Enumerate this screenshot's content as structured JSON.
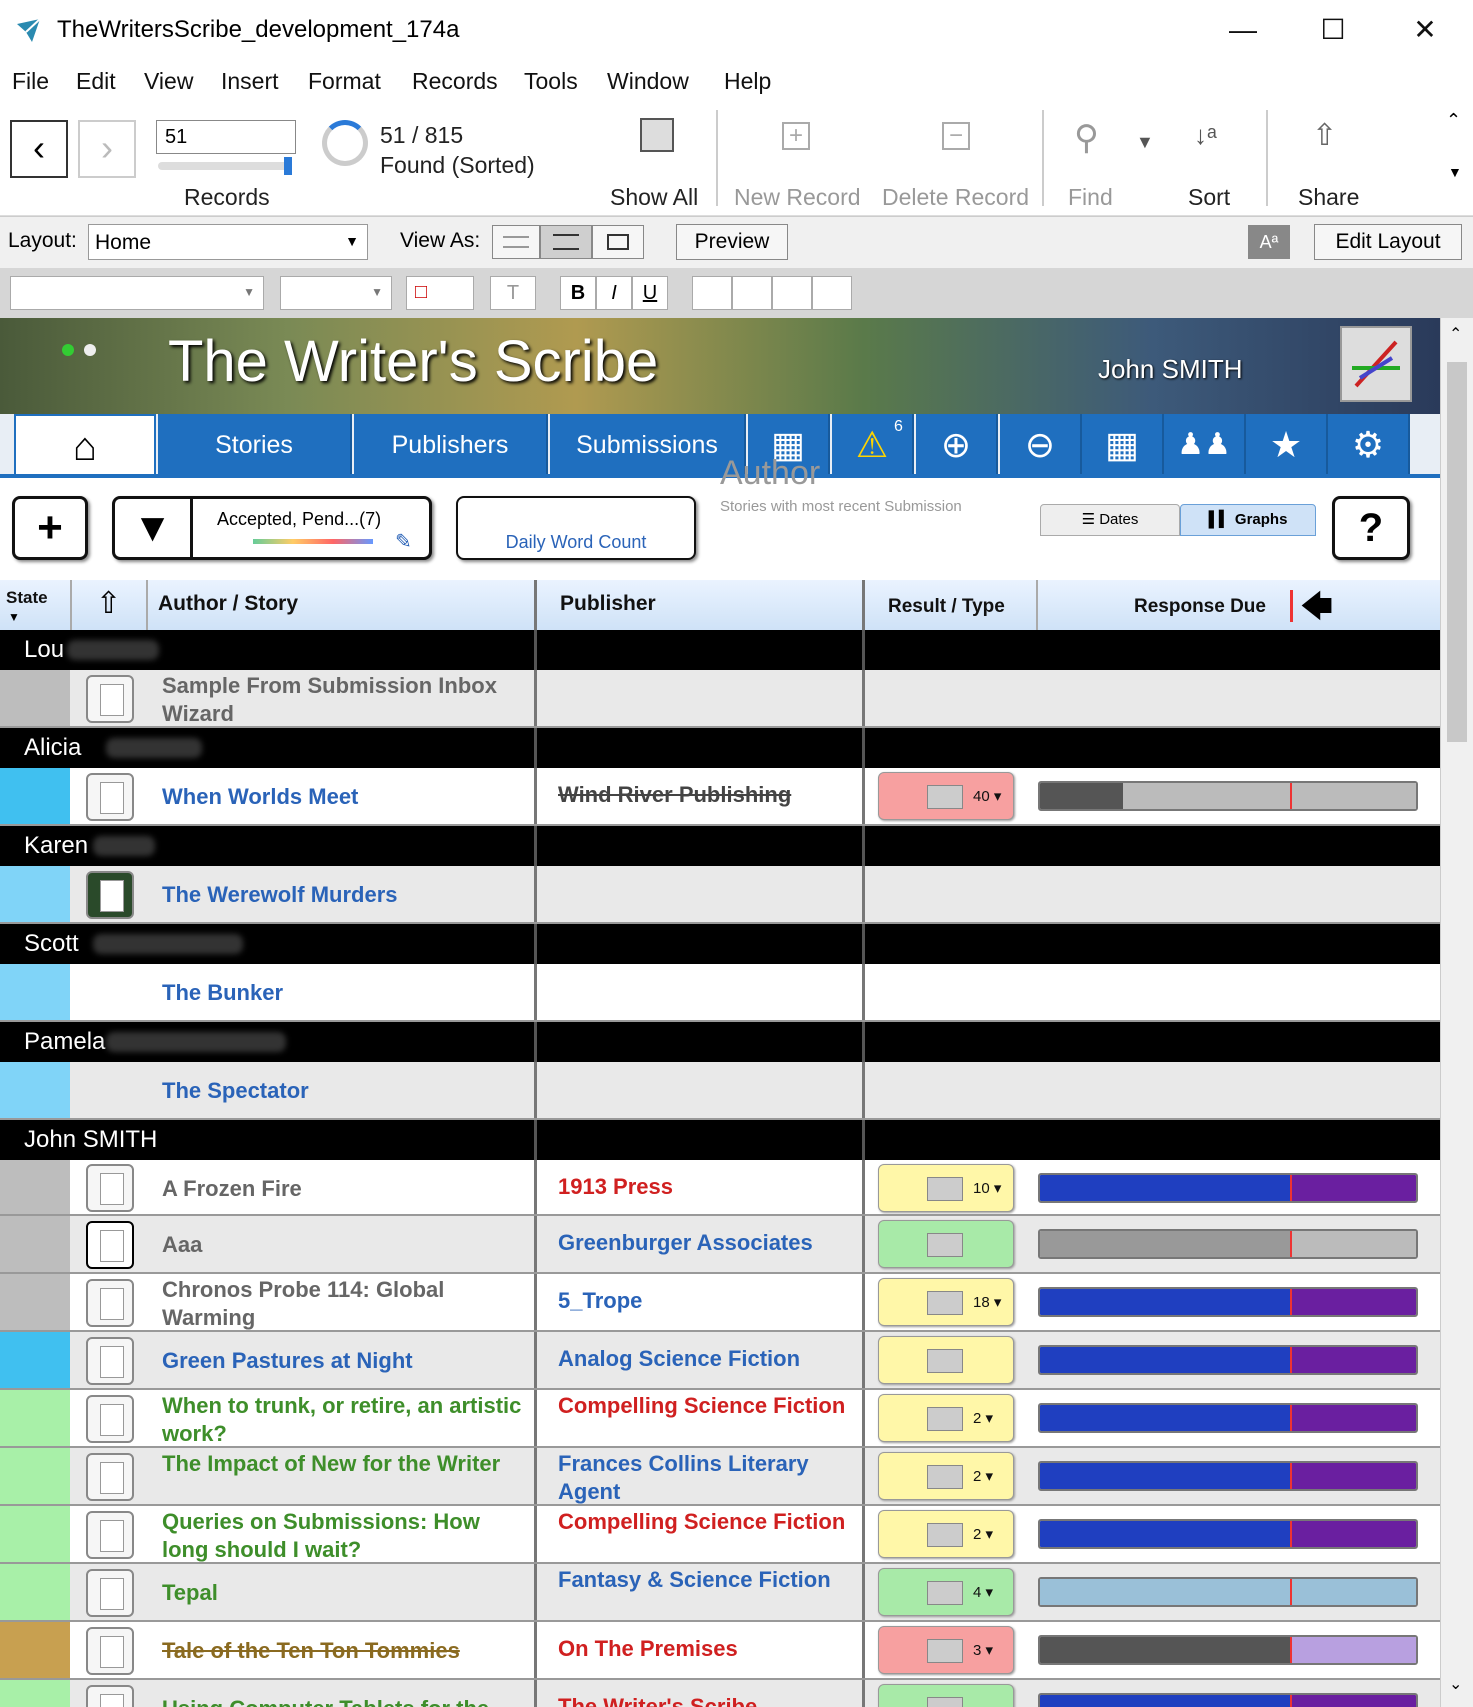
{
  "window": {
    "title": "TheWritersScribe_development_174a"
  },
  "menu": [
    "File",
    "Edit",
    "View",
    "Insert",
    "Format",
    "Records",
    "Tools",
    "Window",
    "Help"
  ],
  "toolbar": {
    "record_input": "51",
    "records_label": "Records",
    "found_count": "51 / 815",
    "found_status": "Found (Sorted)",
    "show_all": "Show All",
    "new_record": "New Record",
    "delete_record": "Delete Record",
    "find": "Find",
    "sort": "Sort",
    "share": "Share"
  },
  "layoutbar": {
    "layout_label": "Layout:",
    "layout_value": "Home",
    "view_as": "View As:",
    "preview": "Preview",
    "aa": "Aª",
    "edit_layout": "Edit Layout"
  },
  "banner": {
    "title": "The Writer's Scribe",
    "user": "John SMITH"
  },
  "tabs": {
    "stories": "Stories",
    "publishers": "Publishers",
    "submissions": "Submissions",
    "warning_count": "6"
  },
  "controls": {
    "filter": "Accepted, Pend...(7)",
    "daily_word_count": "Daily Word Count",
    "author_heading": "Author",
    "author_sub": "Stories with most recent Submission",
    "dates_tab": "Dates",
    "graphs_tab": "Graphs"
  },
  "columns": {
    "state": "State",
    "author_story": "Author / Story",
    "publisher": "Publisher",
    "result_type": "Result / Type",
    "response_due": "Response Due"
  },
  "colors": {
    "accent": "#1f6fbf",
    "pending_yellow": "#fff7a8",
    "accepted_green": "#a8eaa8",
    "rejected_pink": "#f7a0a0",
    "story_blue": "#2a63b8",
    "story_green": "#3e8e2a",
    "pub_red": "#d02020"
  },
  "groups": [
    {
      "author": "Lou",
      "stories": [
        {
          "title": "Sample From Submission Inbox Wizard",
          "publisher": "",
          "state": "#bdbdbd",
          "story_color": "#666"
        }
      ]
    },
    {
      "author": "Alicia",
      "stories": [
        {
          "title": "When Worlds Meet",
          "publisher": "Wind River Publishing",
          "state": "#40c0f0",
          "story_color": "#2a63b8",
          "pub_color": "#444",
          "pub_strike": true,
          "result_color": "#f7a0a0",
          "count": "40 ▾",
          "bar": "gray",
          "progress": 0.22
        }
      ]
    },
    {
      "author": "Karen",
      "stories": [
        {
          "title": "The Werewolf Murders",
          "publisher": "",
          "state": "#80d4f8",
          "story_color": "#2a63b8"
        }
      ]
    },
    {
      "author": "Scott",
      "stories": [
        {
          "title": "The Bunker",
          "publisher": "",
          "state": "#80d4f8",
          "story_color": "#2a63b8"
        }
      ]
    },
    {
      "author": "Pamela",
      "stories": [
        {
          "title": "The Spectator",
          "publisher": "",
          "state": "#80d4f8",
          "story_color": "#2a63b8"
        }
      ]
    },
    {
      "author": "John SMITH",
      "stories": [
        {
          "title": "A Frozen Fire",
          "publisher": "1913 Press",
          "state": "#bdbdbd",
          "story_color": "#666",
          "pub_color": "#d02020",
          "result_color": "#fff7a8",
          "count": "10 ▾",
          "bar": "blue"
        },
        {
          "title": "Aaa",
          "publisher": "Greenburger Associates",
          "state": "#bdbdbd",
          "story_color": "#666",
          "pub_color": "#2a63b8",
          "result_color": "#a8eaa8",
          "count": "",
          "bar": "lightgray"
        },
        {
          "title": "Chronos Probe 114: Global Warming",
          "publisher": "5_Trope",
          "state": "#bdbdbd",
          "story_color": "#666",
          "pub_color": "#2a63b8",
          "result_color": "#fff7a8",
          "count": "18 ▾",
          "bar": "blue"
        },
        {
          "title": "Green Pastures at Night",
          "publisher": "Analog Science Fiction",
          "state": "#40c0f0",
          "story_color": "#2a63b8",
          "pub_color": "#2a63b8",
          "result_color": "#fff7a8",
          "count": "",
          "bar": "blue"
        },
        {
          "title": "When to trunk, or retire, an artistic work?",
          "publisher": "Compelling Science Fiction",
          "state": "#a8f0a8",
          "story_color": "#3e8e2a",
          "pub_color": "#d02020",
          "result_color": "#fff7a8",
          "count": "2 ▾",
          "bar": "blue"
        },
        {
          "title": "The Impact of New for the Writer",
          "publisher": "Frances Collins Literary Agent",
          "state": "#a8f0a8",
          "story_color": "#3e8e2a",
          "pub_color": "#2a63b8",
          "result_color": "#fff7a8",
          "count": "2 ▾",
          "bar": "blue"
        },
        {
          "title": "Queries on Submissions: How long should I wait?",
          "publisher": "Compelling Science Fiction",
          "state": "#a8f0a8",
          "story_color": "#3e8e2a",
          "pub_color": "#d02020",
          "result_color": "#fff7a8",
          "count": "2 ▾",
          "bar": "blue"
        },
        {
          "title": "Tepal",
          "publisher": "Fantasy & Science Fiction",
          "state": "#a8f0a8",
          "story_color": "#3e8e2a",
          "pub_color": "#2a63b8",
          "result_color": "#a8eaa8",
          "count": "4 ▾",
          "bar": "lightblue"
        },
        {
          "title": "Tale of the Ten Ton Tommies",
          "publisher": "On The Premises",
          "state": "#c8a050",
          "story_color": "#8a6a20",
          "story_strike": true,
          "pub_color": "#d02020",
          "result_color": "#f7a0a0",
          "count": "3 ▾",
          "bar": "graypurple"
        },
        {
          "title": "Using Computer Tablets for the",
          "publisher": "The Writer's Scribe",
          "state": "#a8f0a8",
          "story_color": "#3e8e2a",
          "pub_color": "#d02020",
          "result_color": "#a8eaa8",
          "count": "",
          "bar": "blue"
        }
      ]
    }
  ]
}
